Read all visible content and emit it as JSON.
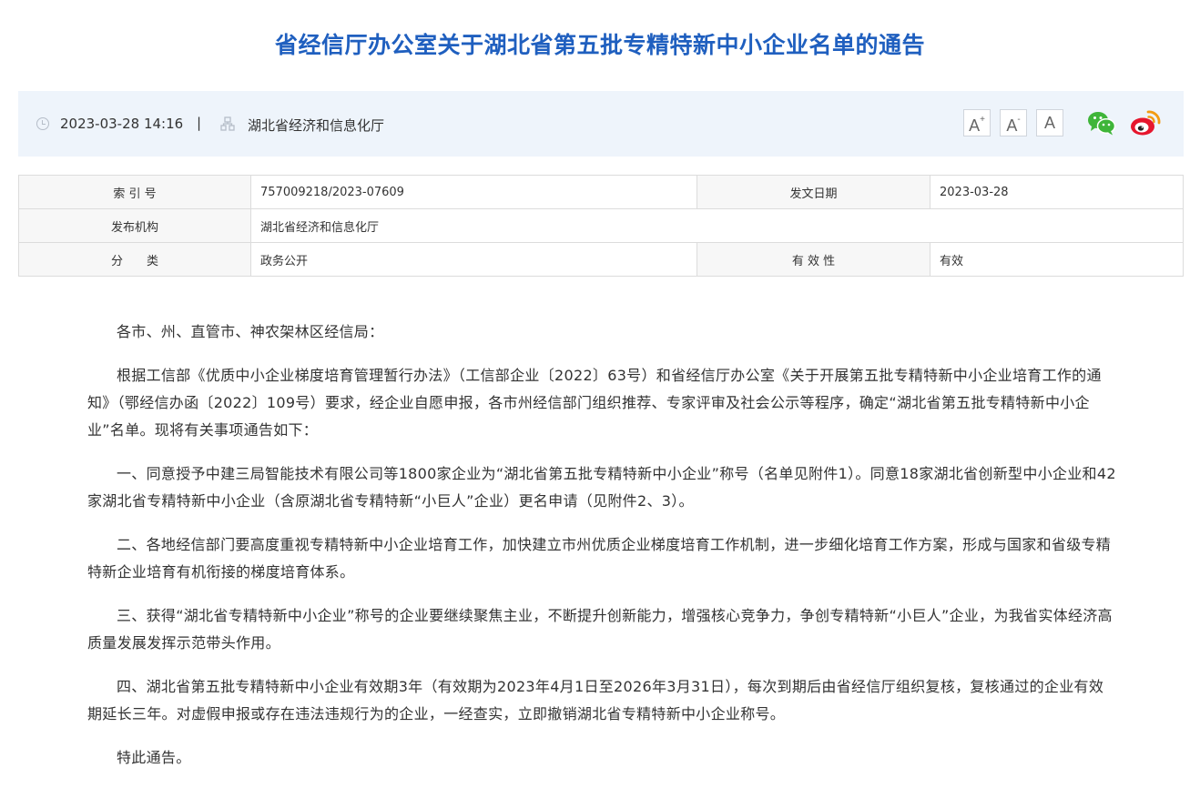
{
  "title": "省经信厅办公室关于湖北省第五批专精特新中小企业名单的通告",
  "info": {
    "datetime": "2023-03-28 14:16",
    "separator": "|",
    "publisher": "湖北省经济和信息化厅",
    "font_increase_label": "A",
    "font_increase_sup": "+",
    "font_decrease_label": "A",
    "font_decrease_sup": "-",
    "font_default_label": "A"
  },
  "meta": {
    "index_label": "索 引 号",
    "index_value": "757009218/2023-07609",
    "date_label": "发文日期",
    "date_value": "2023-03-28",
    "org_label": "发布机构",
    "org_value": "湖北省经济和信息化厅",
    "category_label": "分　　类",
    "category_value": "政务公开",
    "validity_label": "有 效 性",
    "validity_value": "有效"
  },
  "body": {
    "p1": "各市、州、直管市、神农架林区经信局：",
    "p2": "根据工信部《优质中小企业梯度培育管理暂行办法》（工信部企业〔2022〕63号）和省经信厅办公室《关于开展第五批专精特新中小企业培育工作的通知》（鄂经信办函〔2022〕109号）要求，经企业自愿申报，各市州经信部门组织推荐、专家评审及社会公示等程序，确定“湖北省第五批专精特新中小企业”名单。现将有关事项通告如下：",
    "p3": "一、同意授予中建三局智能技术有限公司等1800家企业为“湖北省第五批专精特新中小企业”称号（名单见附件1）。同意18家湖北省创新型中小企业和42家湖北省专精特新中小企业（含原湖北省专精特新“小巨人”企业）更名申请（见附件2、3）。",
    "p4": "二、各地经信部门要高度重视专精特新中小企业培育工作，加快建立市州优质企业梯度培育工作机制，进一步细化培育工作方案，形成与国家和省级专精特新企业培育有机衔接的梯度培育体系。",
    "p5": "三、获得“湖北省专精特新中小企业”称号的企业要继续聚焦主业，不断提升创新能力，增强核心竞争力，争创专精特新“小巨人”企业，为我省实体经济高质量发展发挥示范带头作用。",
    "p6": "四、湖北省第五批专精特新中小企业有效期3年（有效期为2023年4月1日至2026年3月31日），每次到期后由省经信厅组织复核，复核通过的企业有效期延长三年。对虚假申报或存在违法违规行为的企业，一经查实，立即撤销湖北省专精特新中小企业称号。",
    "p7": "特此通告。"
  },
  "icons": {
    "clock": "clock-icon",
    "org": "building-icon",
    "wechat": "wechat-icon",
    "weibo": "weibo-icon"
  },
  "colors": {
    "title": "#1f5fbf",
    "info_bar_bg": "#eef4fb",
    "wechat": "#3fb539",
    "weibo": "#e6162d"
  }
}
